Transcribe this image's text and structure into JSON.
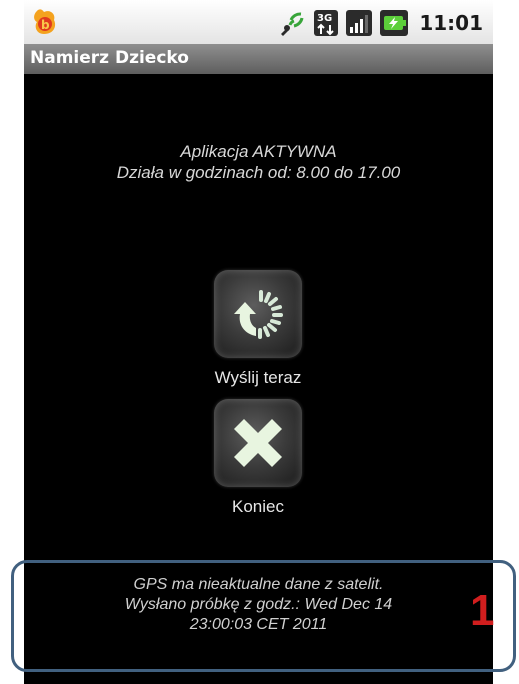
{
  "status_bar": {
    "time": "11:01",
    "network_badge": "3G",
    "icons": [
      "app-logo-icon",
      "gps-signal-icon",
      "3g-network-icon",
      "signal-strength-icon",
      "battery-charging-icon"
    ]
  },
  "app": {
    "title": "Namierz Dziecko"
  },
  "status": {
    "line1": "Aplikacja AKTYWNA",
    "line2": "Działa w godzinach od: 8.00 do 17.00"
  },
  "actions": {
    "send_now": {
      "label": "Wyślij teraz",
      "icon": "refresh-send-icon"
    },
    "exit": {
      "label": "Koniec",
      "icon": "close-x-icon"
    }
  },
  "footer": {
    "line1": "GPS ma nieaktualne dane z satelit.",
    "line2": "Wysłano próbkę z godz.: Wed Dec 14",
    "line3": "23:00:03 CET 2011"
  },
  "annotation": {
    "number": "1",
    "border_color": "#41607f",
    "number_color": "#d11e1e"
  }
}
